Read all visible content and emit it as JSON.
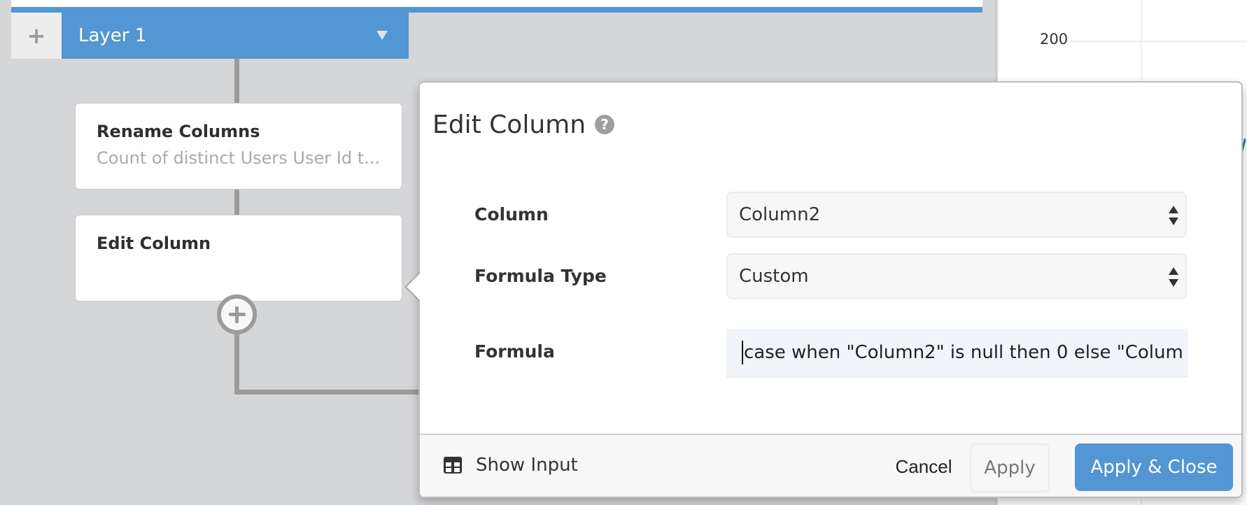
{
  "layer": {
    "add_icon": "plus-icon",
    "tab_label": "Layer 1",
    "dropdown_icon": "caret-down-icon",
    "accent_color": "#5296d3"
  },
  "steps": [
    {
      "title": "Rename Columns",
      "subtitle": "Count of distinct Users User Id t..."
    },
    {
      "title": "Edit Column",
      "subtitle": ""
    }
  ],
  "add_step_icon": "plus-circle-icon",
  "chart_peek": {
    "y_tick": "200"
  },
  "popover": {
    "title": "Edit Column",
    "help_icon": "question-circle-icon",
    "help_glyph": "?",
    "fields": {
      "column": {
        "label": "Column",
        "value": "Column2"
      },
      "formula_type": {
        "label": "Formula Type",
        "value": "Custom"
      },
      "formula": {
        "label": "Formula",
        "value": "case when \"Column2\" is null then 0 else \"Colum"
      }
    },
    "footer": {
      "show_input_icon": "table-icon",
      "show_input_label": "Show Input",
      "cancel_label": "Cancel",
      "apply_label": "Apply",
      "apply_close_label": "Apply & Close"
    }
  }
}
